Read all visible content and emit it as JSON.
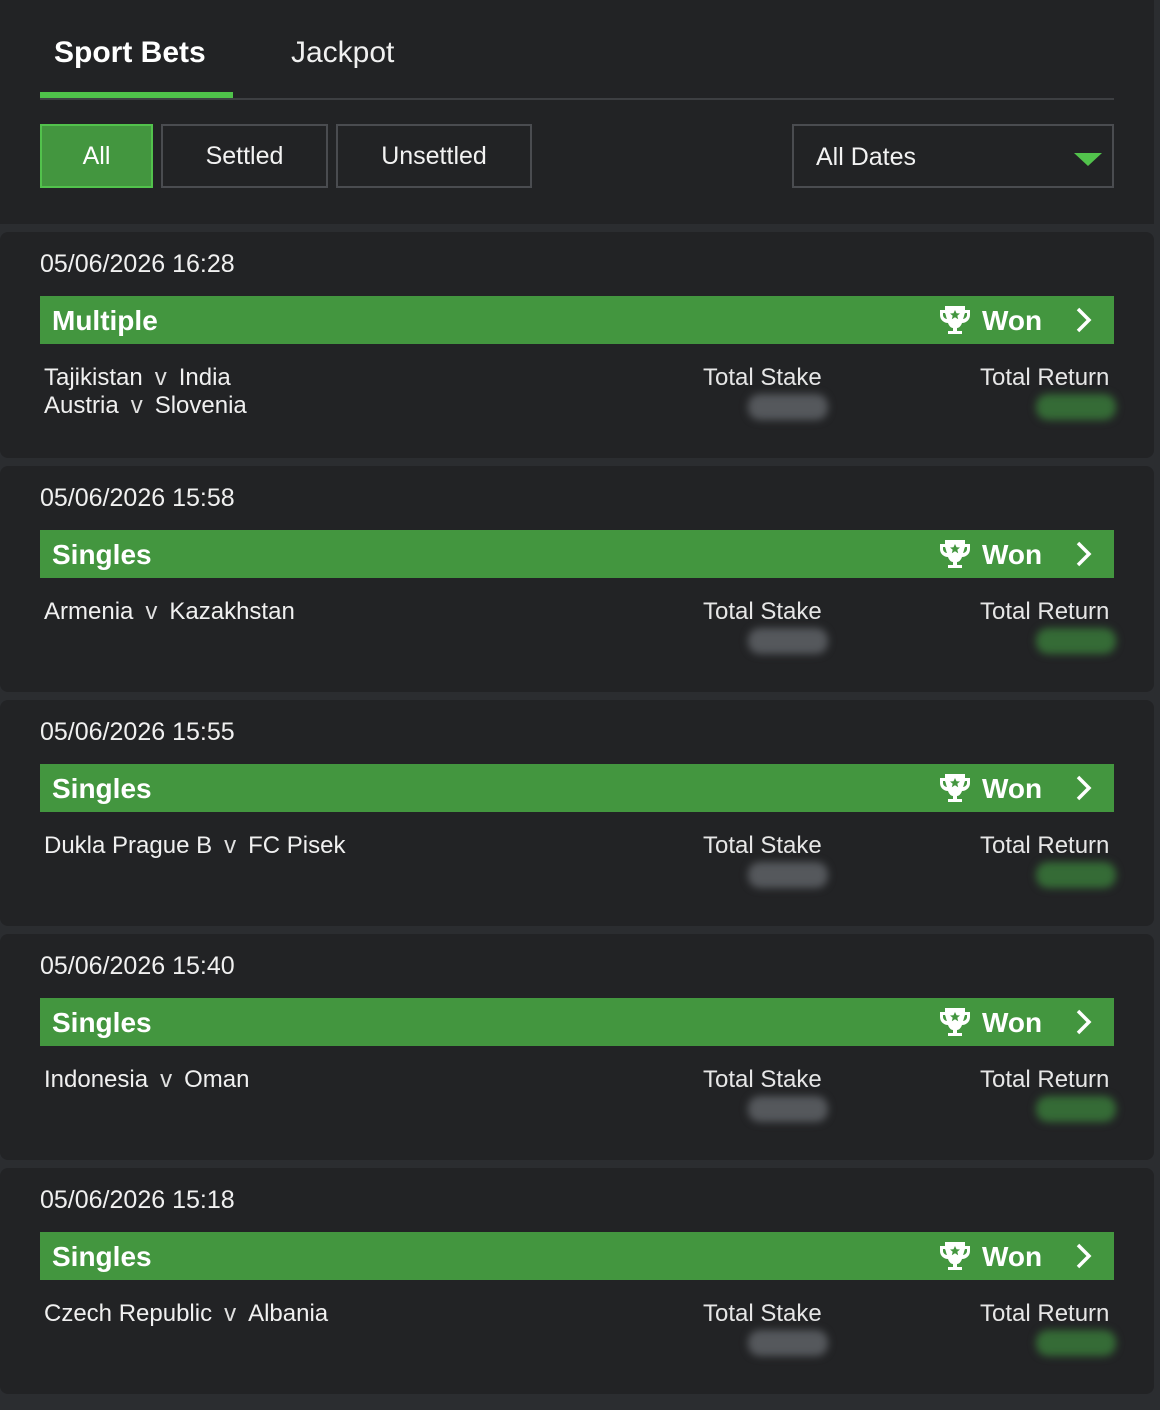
{
  "tabs": [
    {
      "label": "Sport Bets"
    },
    {
      "label": "Jackpot"
    }
  ],
  "filters": [
    {
      "label": "All"
    },
    {
      "label": "Settled"
    },
    {
      "label": "Unsettled"
    }
  ],
  "date_filter": {
    "label": "All Dates"
  },
  "colors": {
    "accent": "#52c24c",
    "won_bar": "#43963f",
    "background": "#2b2d30",
    "card": "#222325"
  },
  "icons": {
    "status": "trophy-icon",
    "open": "chevron-right-icon",
    "dropdown": "caret-down-icon"
  },
  "bets": [
    {
      "datetime": "05/06/2026 16:28",
      "type": "Multiple",
      "status": "Won",
      "matches": [
        {
          "home": "Tajikistan",
          "away": "India"
        },
        {
          "home": "Austria",
          "away": "Slovenia"
        }
      ],
      "stake_label": "Total Stake",
      "return_label": "Total Return"
    },
    {
      "datetime": "05/06/2026 15:58",
      "type": "Singles",
      "status": "Won",
      "matches": [
        {
          "home": "Armenia",
          "away": "Kazakhstan"
        }
      ],
      "stake_label": "Total Stake",
      "return_label": "Total Return"
    },
    {
      "datetime": "05/06/2026 15:55",
      "type": "Singles",
      "status": "Won",
      "matches": [
        {
          "home": "Dukla Prague B",
          "away": "FC Pisek"
        }
      ],
      "stake_label": "Total Stake",
      "return_label": "Total Return"
    },
    {
      "datetime": "05/06/2026 15:40",
      "type": "Singles",
      "status": "Won",
      "matches": [
        {
          "home": "Indonesia",
          "away": "Oman"
        }
      ],
      "stake_label": "Total Stake",
      "return_label": "Total Return"
    },
    {
      "datetime": "05/06/2026 15:18",
      "type": "Singles",
      "status": "Won",
      "matches": [
        {
          "home": "Czech Republic",
          "away": "Albania"
        }
      ],
      "stake_label": "Total Stake",
      "return_label": "Total Return"
    }
  ],
  "vs_label": "v"
}
